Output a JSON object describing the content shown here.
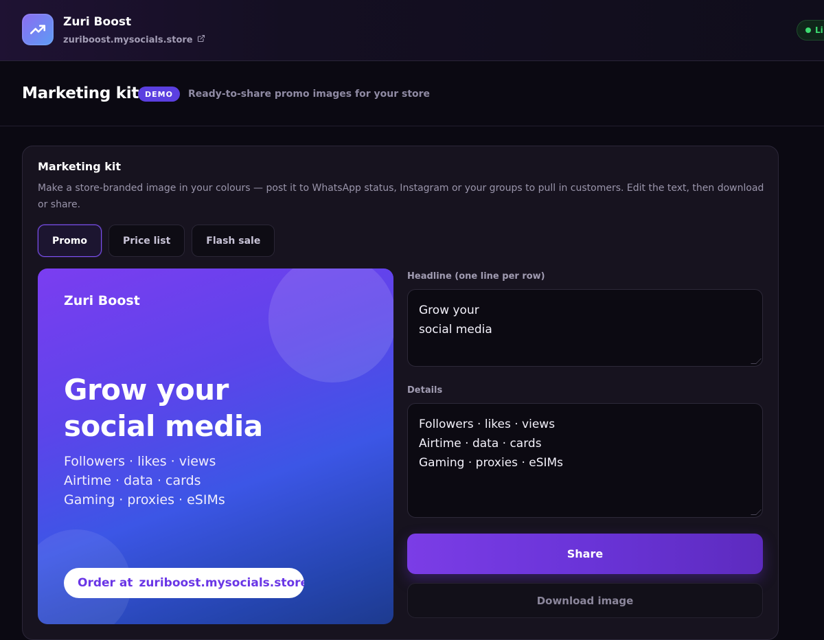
{
  "store": {
    "name": "Zuri Boost",
    "url": "zuriboost.mysocials.store",
    "status": "Li"
  },
  "header": {
    "title": "Marketing kit",
    "badge": "DEMO",
    "subtitle": "Ready-to-share promo images for your store"
  },
  "card": {
    "title": "Marketing kit",
    "description": "Make a store-branded image in your colours — post it to WhatsApp status, Instagram or your groups to pull in customers. Edit the text, then download or share.",
    "tabs": [
      {
        "label": "Promo",
        "active": true
      },
      {
        "label": "Price list",
        "active": false
      },
      {
        "label": "Flash sale",
        "active": false
      }
    ]
  },
  "preview": {
    "store_name": "Zuri Boost",
    "headline_lines": [
      "Grow your",
      "social media"
    ],
    "detail_lines": [
      "Followers · likes · views",
      "Airtime · data · cards",
      "Gaming · proxies · eSIMs"
    ],
    "cta_prefix": "Order at",
    "cta_url": "zuriboost.mysocials.store"
  },
  "form": {
    "headline_label": "Headline (one line per row)",
    "headline_lines": [
      "Grow your",
      "social media"
    ],
    "details_label": "Details",
    "details_lines": [
      "Followers · likes · views",
      "Airtime · data · cards",
      "Gaming · proxies · eSIMs"
    ],
    "share_label": "Share",
    "download_label": "Download image"
  },
  "colors": {
    "accent": "#7b3de6",
    "badge": "#5b3fe0",
    "live": "#3ddc71",
    "background": "#0b0912"
  },
  "icons": {
    "app": "trending-up-icon",
    "external_link": "external-link-icon"
  }
}
